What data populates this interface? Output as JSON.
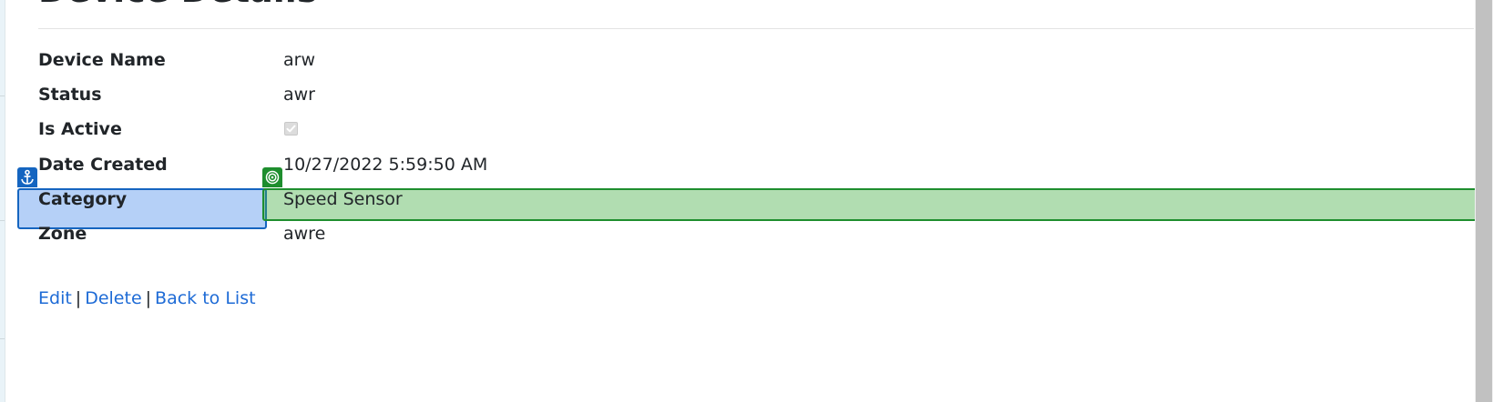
{
  "page": {
    "title": "Device Details"
  },
  "details": [
    {
      "label": "Device Name",
      "value": "arw"
    },
    {
      "label": "Status",
      "value": "awr"
    },
    {
      "label": "Is Active",
      "value": "",
      "checked": true
    },
    {
      "label": "Date Created",
      "value": "10/27/2022 5:59:50 AM"
    },
    {
      "label": "Category",
      "value": "Speed Sensor"
    },
    {
      "label": "Zone",
      "value": "awre"
    }
  ],
  "actions": {
    "edit": "Edit",
    "delete": "Delete",
    "back": "Back to List",
    "separator": "|"
  },
  "overlays": {
    "anchor_icon": "anchor-icon",
    "target_icon": "target-icon",
    "anchor_color": "#1565c0",
    "target_color": "#1e8e2e"
  },
  "colors": {
    "link": "#1e6bd6",
    "text": "#212529"
  }
}
